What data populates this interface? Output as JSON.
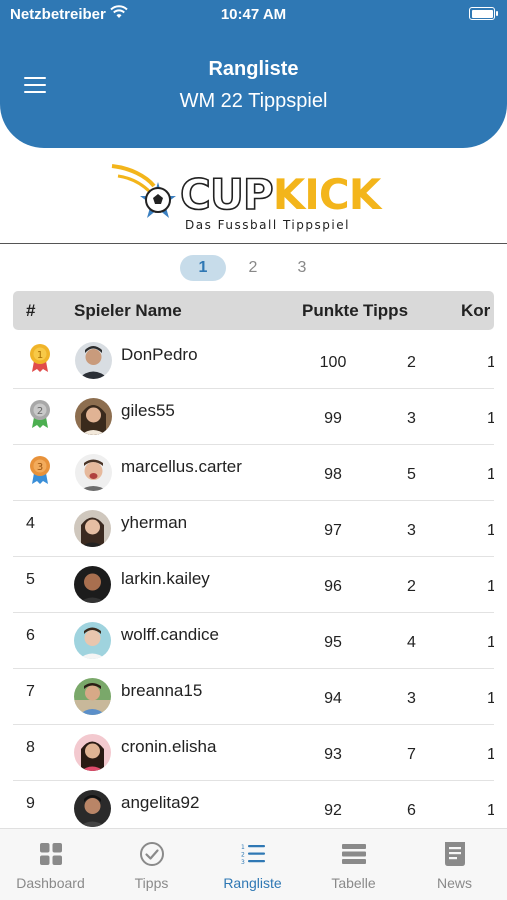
{
  "status_bar": {
    "carrier": "Netzbetreiber",
    "time": "10:47 AM"
  },
  "header": {
    "title": "Rangliste",
    "subtitle": "WM 22 Tippspiel",
    "bg_color": "#2f78b4"
  },
  "logo": {
    "word1": "CUP",
    "word2": "KICK",
    "tagline": "Das Fussball Tippspiel",
    "accent_color": "#f3b51b"
  },
  "pager": {
    "pages": [
      "1",
      "2",
      "3"
    ],
    "active": "1"
  },
  "table": {
    "columns": [
      "#",
      "Spieler Name",
      "Punkte",
      "Tipps",
      "Kor"
    ],
    "rows": [
      {
        "rank": "1",
        "medal": "gold",
        "name": "DonPedro",
        "punkte": "100",
        "tipps": "2",
        "kor": "1"
      },
      {
        "rank": "2",
        "medal": "silver",
        "name": "giles55",
        "punkte": "99",
        "tipps": "3",
        "kor": "1"
      },
      {
        "rank": "3",
        "medal": "bronze",
        "name": "marcellus.carter",
        "punkte": "98",
        "tipps": "5",
        "kor": "1"
      },
      {
        "rank": "4",
        "medal": "",
        "name": "yherman",
        "punkte": "97",
        "tipps": "3",
        "kor": "1"
      },
      {
        "rank": "5",
        "medal": "",
        "name": "larkin.kailey",
        "punkte": "96",
        "tipps": "2",
        "kor": "1"
      },
      {
        "rank": "6",
        "medal": "",
        "name": "wolff.candice",
        "punkte": "95",
        "tipps": "4",
        "kor": "1"
      },
      {
        "rank": "7",
        "medal": "",
        "name": "breanna15",
        "punkte": "94",
        "tipps": "3",
        "kor": "1"
      },
      {
        "rank": "8",
        "medal": "",
        "name": "cronin.elisha",
        "punkte": "93",
        "tipps": "7",
        "kor": "1"
      },
      {
        "rank": "9",
        "medal": "",
        "name": "angelita92",
        "punkte": "92",
        "tipps": "6",
        "kor": "1"
      }
    ]
  },
  "tabbar": {
    "items": [
      {
        "label": "Dashboard",
        "icon": "grid-icon"
      },
      {
        "label": "Tipps",
        "icon": "check-circle-icon"
      },
      {
        "label": "Rangliste",
        "icon": "list-icon"
      },
      {
        "label": "Tabelle",
        "icon": "table-icon"
      },
      {
        "label": "News",
        "icon": "news-icon"
      }
    ],
    "active": "Rangliste",
    "active_color": "#2f78b4"
  }
}
